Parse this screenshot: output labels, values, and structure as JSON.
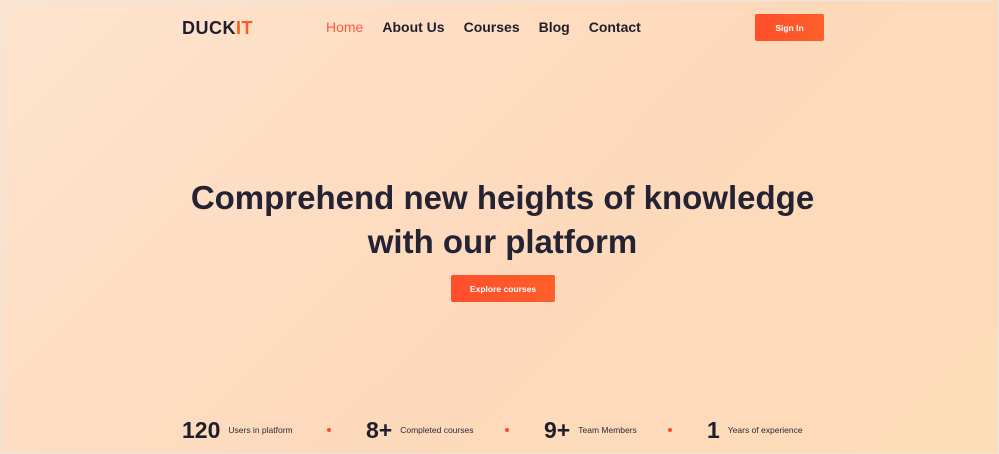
{
  "brand": {
    "prefix": "DUCK",
    "accent": "IT",
    "accent_color": "#ff5a1f"
  },
  "nav": {
    "items": [
      {
        "label": "Home",
        "active": true
      },
      {
        "label": "About Us"
      },
      {
        "label": "Courses"
      },
      {
        "label": "Blog"
      },
      {
        "label": "Contact"
      }
    ]
  },
  "header": {
    "signin_label": "Sign In"
  },
  "hero": {
    "headline_line1": "Comprehend new heights of knowledge",
    "headline_line2": "with our platform",
    "cta_label": "Explore courses"
  },
  "stats": [
    {
      "value": "120",
      "label": "Users in platform"
    },
    {
      "value": "8+",
      "label": "Completed courses"
    },
    {
      "value": "9+",
      "label": "Team Members"
    },
    {
      "value": "1",
      "label": "Years of experience"
    }
  ],
  "colors": {
    "primary": "#ff5a2a",
    "text": "#1f1f2b"
  }
}
